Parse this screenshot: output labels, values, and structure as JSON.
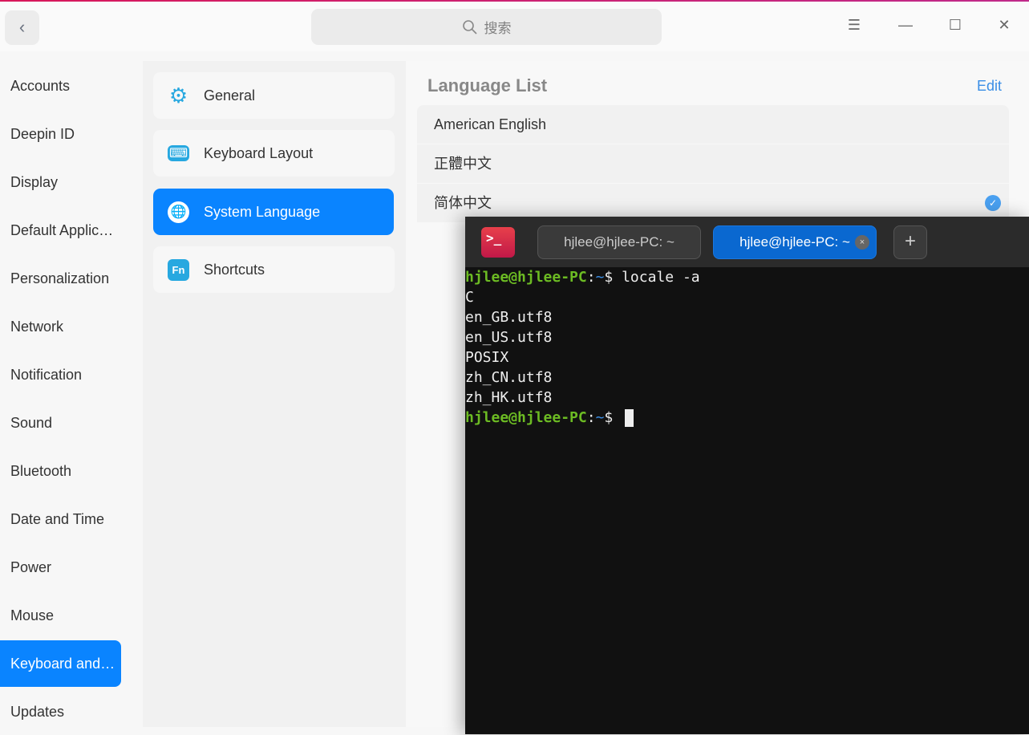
{
  "titlebar": {
    "back": "‹",
    "search_placeholder": "搜索",
    "menu": "☰",
    "minimize": "—",
    "maximize": "☐",
    "close": "✕"
  },
  "sidebar": {
    "items": [
      "Accounts",
      "Deepin ID",
      "Display",
      "Default Applic…",
      "Personalization",
      "Network",
      "Notification",
      "Sound",
      "Bluetooth",
      "Date and Time",
      "Power",
      "Mouse",
      "Keyboard and…",
      "Updates"
    ],
    "active": 12
  },
  "middle": {
    "items": [
      {
        "label": "General",
        "icon": "⚙"
      },
      {
        "label": "Keyboard Layout",
        "icon": "⌨"
      },
      {
        "label": "System Language",
        "icon": "🌐"
      },
      {
        "label": "Shortcuts",
        "icon": "Fn"
      }
    ],
    "active": 2
  },
  "language": {
    "title": "Language List",
    "edit": "Edit",
    "items": [
      "American English",
      "正體中文",
      "简体中文"
    ],
    "checked": 2
  },
  "terminal": {
    "icon": ">_",
    "tabs": [
      "hjlee@hjlee-PC: ~",
      "hjlee@hjlee-PC: ~"
    ],
    "active_tab": 1,
    "tab_close": "×",
    "new_tab": "+",
    "prompt_user": "hjlee@hjlee-PC",
    "prompt_sep": ":",
    "prompt_dir": "~",
    "prompt_sym": "$ ",
    "command": "locale -a",
    "output": [
      "C",
      "en_GB.utf8",
      "en_US.utf8",
      "POSIX",
      "zh_CN.utf8",
      "zh_HK.utf8"
    ]
  }
}
